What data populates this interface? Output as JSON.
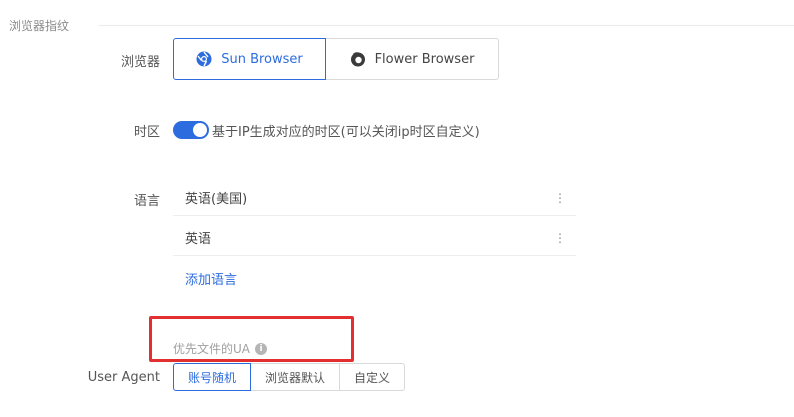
{
  "section": {
    "title": "浏览器指纹"
  },
  "browser": {
    "label": "浏览器",
    "options": [
      "Sun Browser",
      "Flower Browser"
    ],
    "selected": "Sun Browser"
  },
  "timezone": {
    "label": "时区",
    "enabled": true,
    "description": "基于IP生成对应的时区(可以关闭ip时区自定义)"
  },
  "language": {
    "label": "语言",
    "items": [
      "英语(美国)",
      "英语"
    ],
    "add_label": "添加语言",
    "menu_glyph": "⋮"
  },
  "prefer_ua": {
    "label": "优先文件的UA",
    "info_glyph": "i"
  },
  "user_agent": {
    "label": "User Agent",
    "options": [
      "账号随机",
      "浏览器默认",
      "自定义"
    ],
    "selected": "账号随机"
  },
  "colors": {
    "accent": "#2d6cdf",
    "highlight_box": "#e23030"
  }
}
